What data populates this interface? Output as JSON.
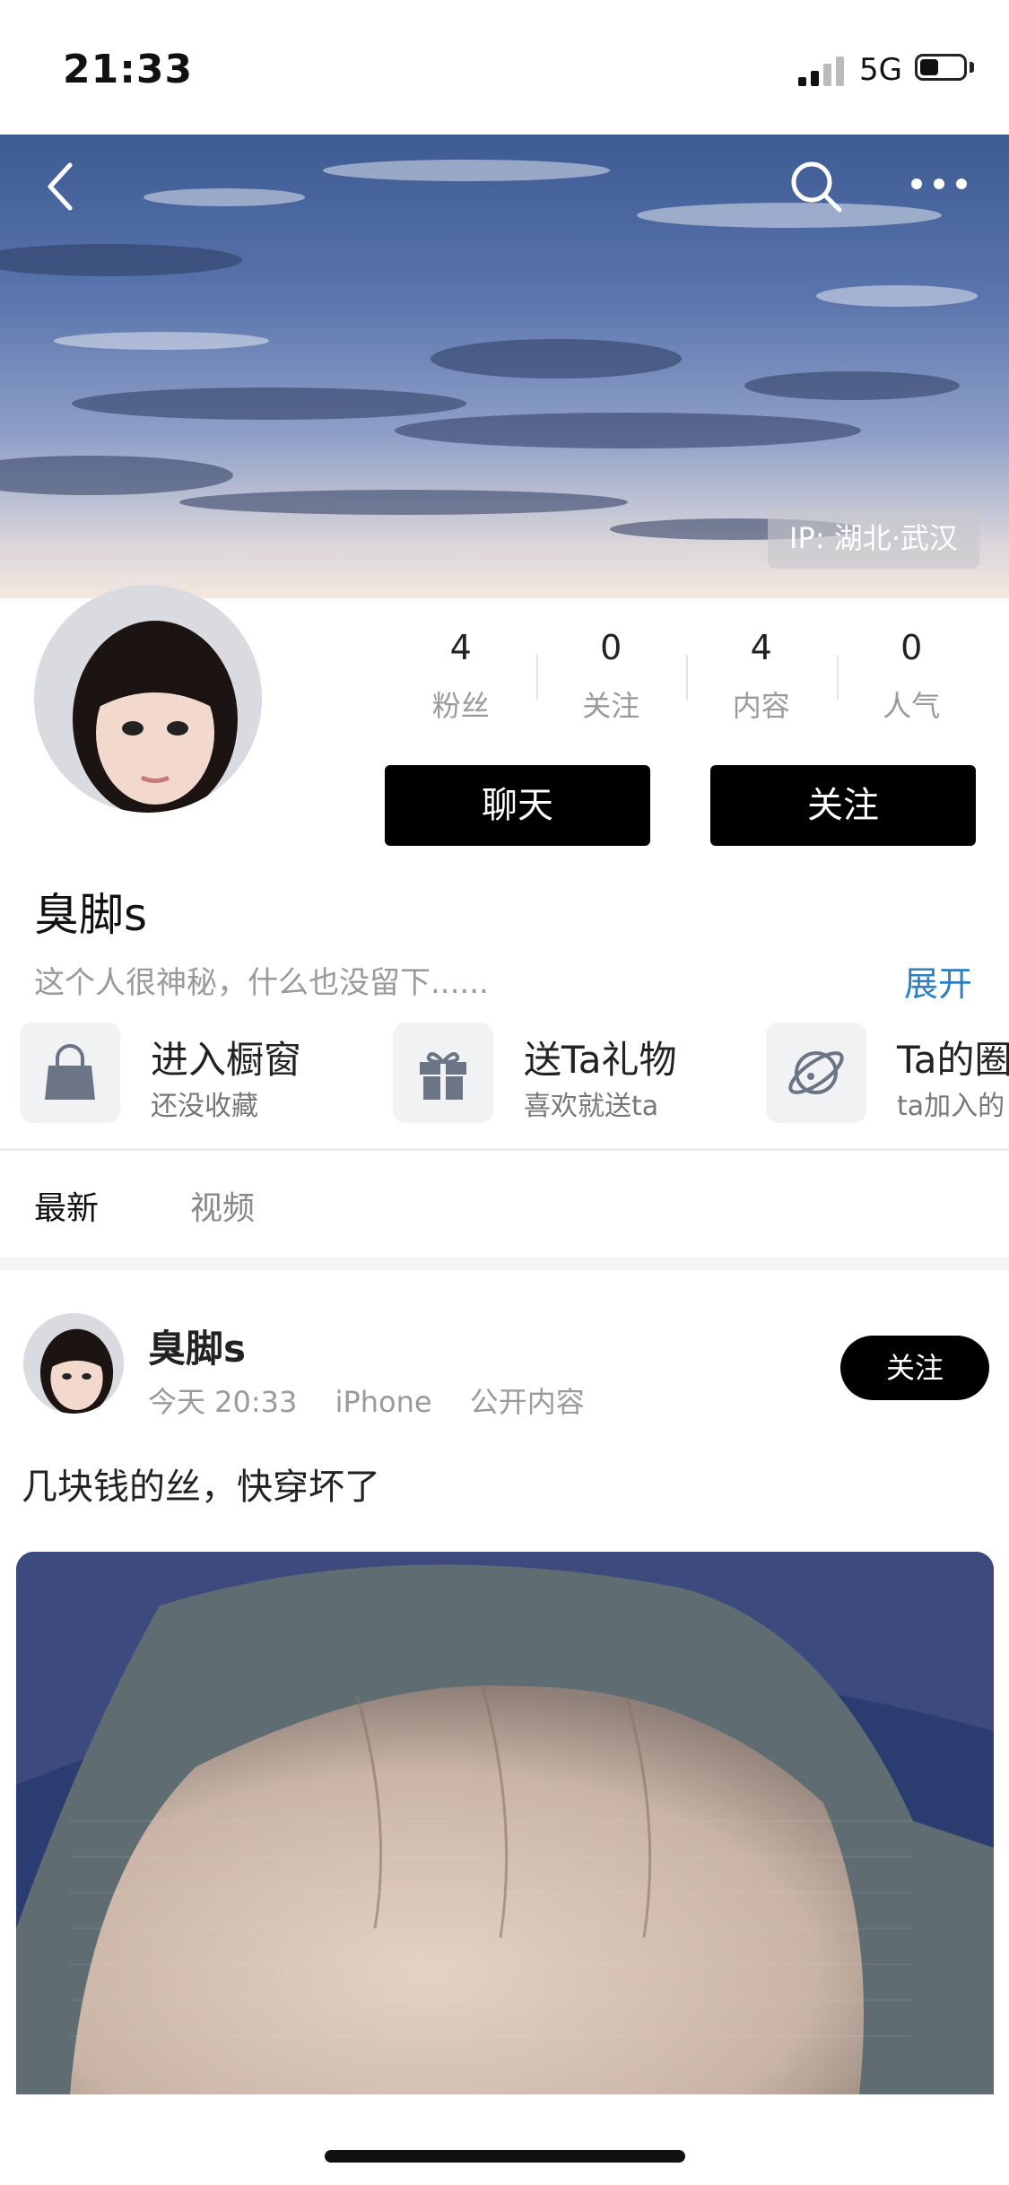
{
  "status_bar": {
    "time": "21:33",
    "network": "5G"
  },
  "header": {
    "ip_label": "IP: 湖北·武汉"
  },
  "stats": [
    {
      "value": "4",
      "label": "粉丝"
    },
    {
      "value": "0",
      "label": "关注"
    },
    {
      "value": "4",
      "label": "内容"
    },
    {
      "value": "0",
      "label": "人气"
    }
  ],
  "actions": {
    "chat": "聊天",
    "follow": "关注"
  },
  "profile": {
    "name": "臭脚s",
    "bio": "这个人很神秘，什么也没留下......",
    "expand": "展开"
  },
  "shortcuts": [
    {
      "title": "进入橱窗",
      "subtitle": "还没收藏",
      "icon": "shopping-bag-icon"
    },
    {
      "title": "送Ta礼物",
      "subtitle": "喜欢就送ta",
      "icon": "gift-icon"
    },
    {
      "title": "Ta的圈",
      "subtitle": "ta加入的",
      "icon": "planet-icon"
    }
  ],
  "tabs": [
    {
      "label": "最新"
    },
    {
      "label": "视频"
    }
  ],
  "post": {
    "user": "臭脚s",
    "time": "今天 20:33",
    "device": "iPhone",
    "visibility": "公开内容",
    "follow": "关注",
    "text": "几块钱的丝，快穿坏了"
  },
  "colors": {
    "accent_link": "#2b7fc2",
    "button_bg": "#000000"
  }
}
